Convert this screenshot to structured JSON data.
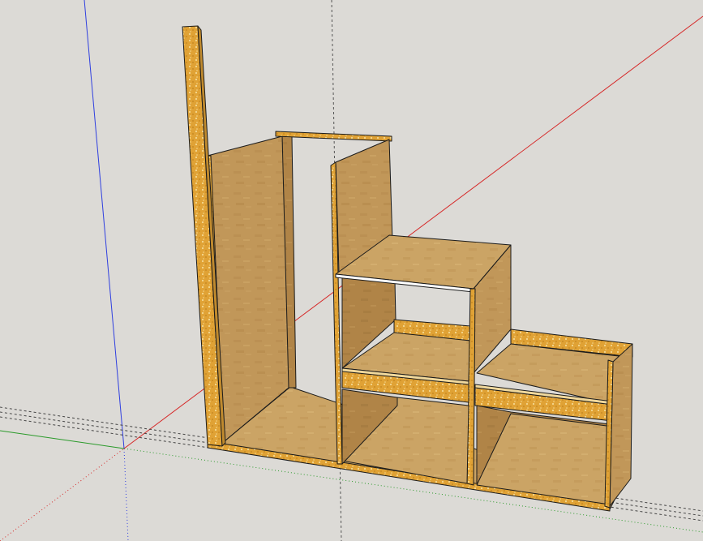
{
  "viewport": {
    "background": "#dcdad6",
    "axis_colors": {
      "red": "#d62828",
      "green": "#2a9a2a",
      "blue": "#2f3fe0"
    }
  },
  "model": {
    "material": "OSB plywood",
    "colors": {
      "panel_face": "#c19759",
      "panel_face_dark": "#a97f45",
      "panel_face_light": "#cfa868",
      "edge": "#e0a235",
      "edge_speckle": "#f4d58c",
      "outline": "#1b1b1b",
      "inner_back": "#b28a52"
    }
  }
}
